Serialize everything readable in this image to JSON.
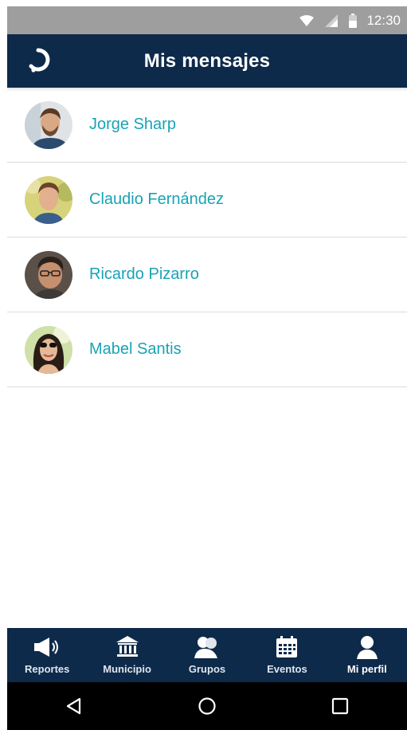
{
  "status_bar": {
    "time": "12:30"
  },
  "app_bar": {
    "title": "Mis mensajes"
  },
  "messages": [
    {
      "name": "Jorge Sharp"
    },
    {
      "name": "Claudio Fernández"
    },
    {
      "name": "Ricardo Pizarro"
    },
    {
      "name": "Mabel Santis"
    }
  ],
  "bottom_nav": [
    {
      "label": "Reportes",
      "icon": "megaphone-icon"
    },
    {
      "label": "Municipio",
      "icon": "building-icon"
    },
    {
      "label": "Grupos",
      "icon": "group-icon"
    },
    {
      "label": "Eventos",
      "icon": "calendar-icon"
    },
    {
      "label": "Mi perfil",
      "icon": "person-icon",
      "active": true
    }
  ],
  "colors": {
    "app_bar": "#0e2a4a",
    "contact_name": "#18a3b5",
    "status_bar": "#9e9e9e"
  }
}
